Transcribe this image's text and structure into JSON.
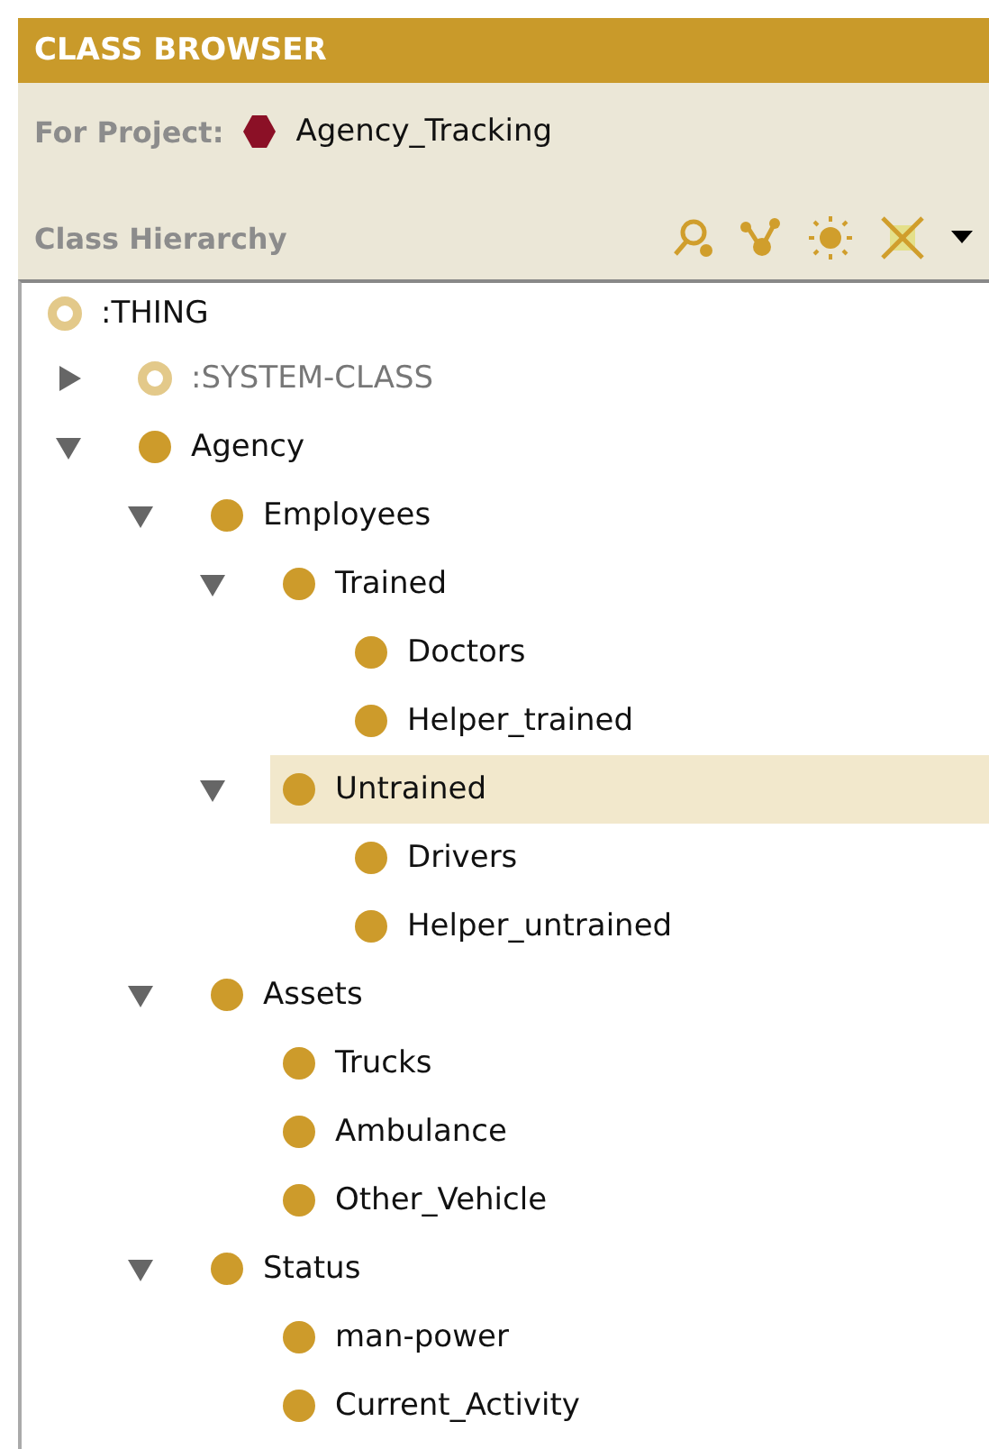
{
  "panel": {
    "title": "CLASS BROWSER",
    "project_label": "For Project:",
    "project_name": "Agency_Tracking",
    "hierarchy_label": "Class Hierarchy"
  },
  "tree": [
    {
      "label": ":THING",
      "abstract": true,
      "selected": false,
      "children": [
        {
          "label": ":SYSTEM-CLASS",
          "abstract": true,
          "selected": false,
          "expanded": false
        },
        {
          "label": "Agency",
          "abstract": false,
          "selected": false,
          "expanded": true,
          "children": [
            {
              "label": "Employees",
              "abstract": false,
              "selected": false,
              "expanded": true,
              "children": [
                {
                  "label": "Trained",
                  "abstract": false,
                  "selected": false,
                  "expanded": true,
                  "children": [
                    {
                      "label": "Doctors",
                      "abstract": false,
                      "selected": false
                    },
                    {
                      "label": "Helper_trained",
                      "abstract": false,
                      "selected": false
                    }
                  ]
                },
                {
                  "label": "Untrained",
                  "abstract": false,
                  "selected": true,
                  "expanded": true,
                  "children": [
                    {
                      "label": "Drivers",
                      "abstract": false,
                      "selected": false
                    },
                    {
                      "label": "Helper_untrained",
                      "abstract": false,
                      "selected": false
                    }
                  ]
                }
              ]
            },
            {
              "label": "Assets",
              "abstract": false,
              "selected": false,
              "expanded": true,
              "children": [
                {
                  "label": "Trucks",
                  "abstract": false,
                  "selected": false
                },
                {
                  "label": "Ambulance",
                  "abstract": false,
                  "selected": false
                },
                {
                  "label": "Other_Vehicle",
                  "abstract": false,
                  "selected": false
                }
              ]
            },
            {
              "label": "Status",
              "abstract": false,
              "selected": false,
              "expanded": true,
              "children": [
                {
                  "label": "man-power",
                  "abstract": false,
                  "selected": false
                },
                {
                  "label": "Current_Activity",
                  "abstract": false,
                  "selected": false
                }
              ]
            }
          ]
        }
      ]
    }
  ]
}
